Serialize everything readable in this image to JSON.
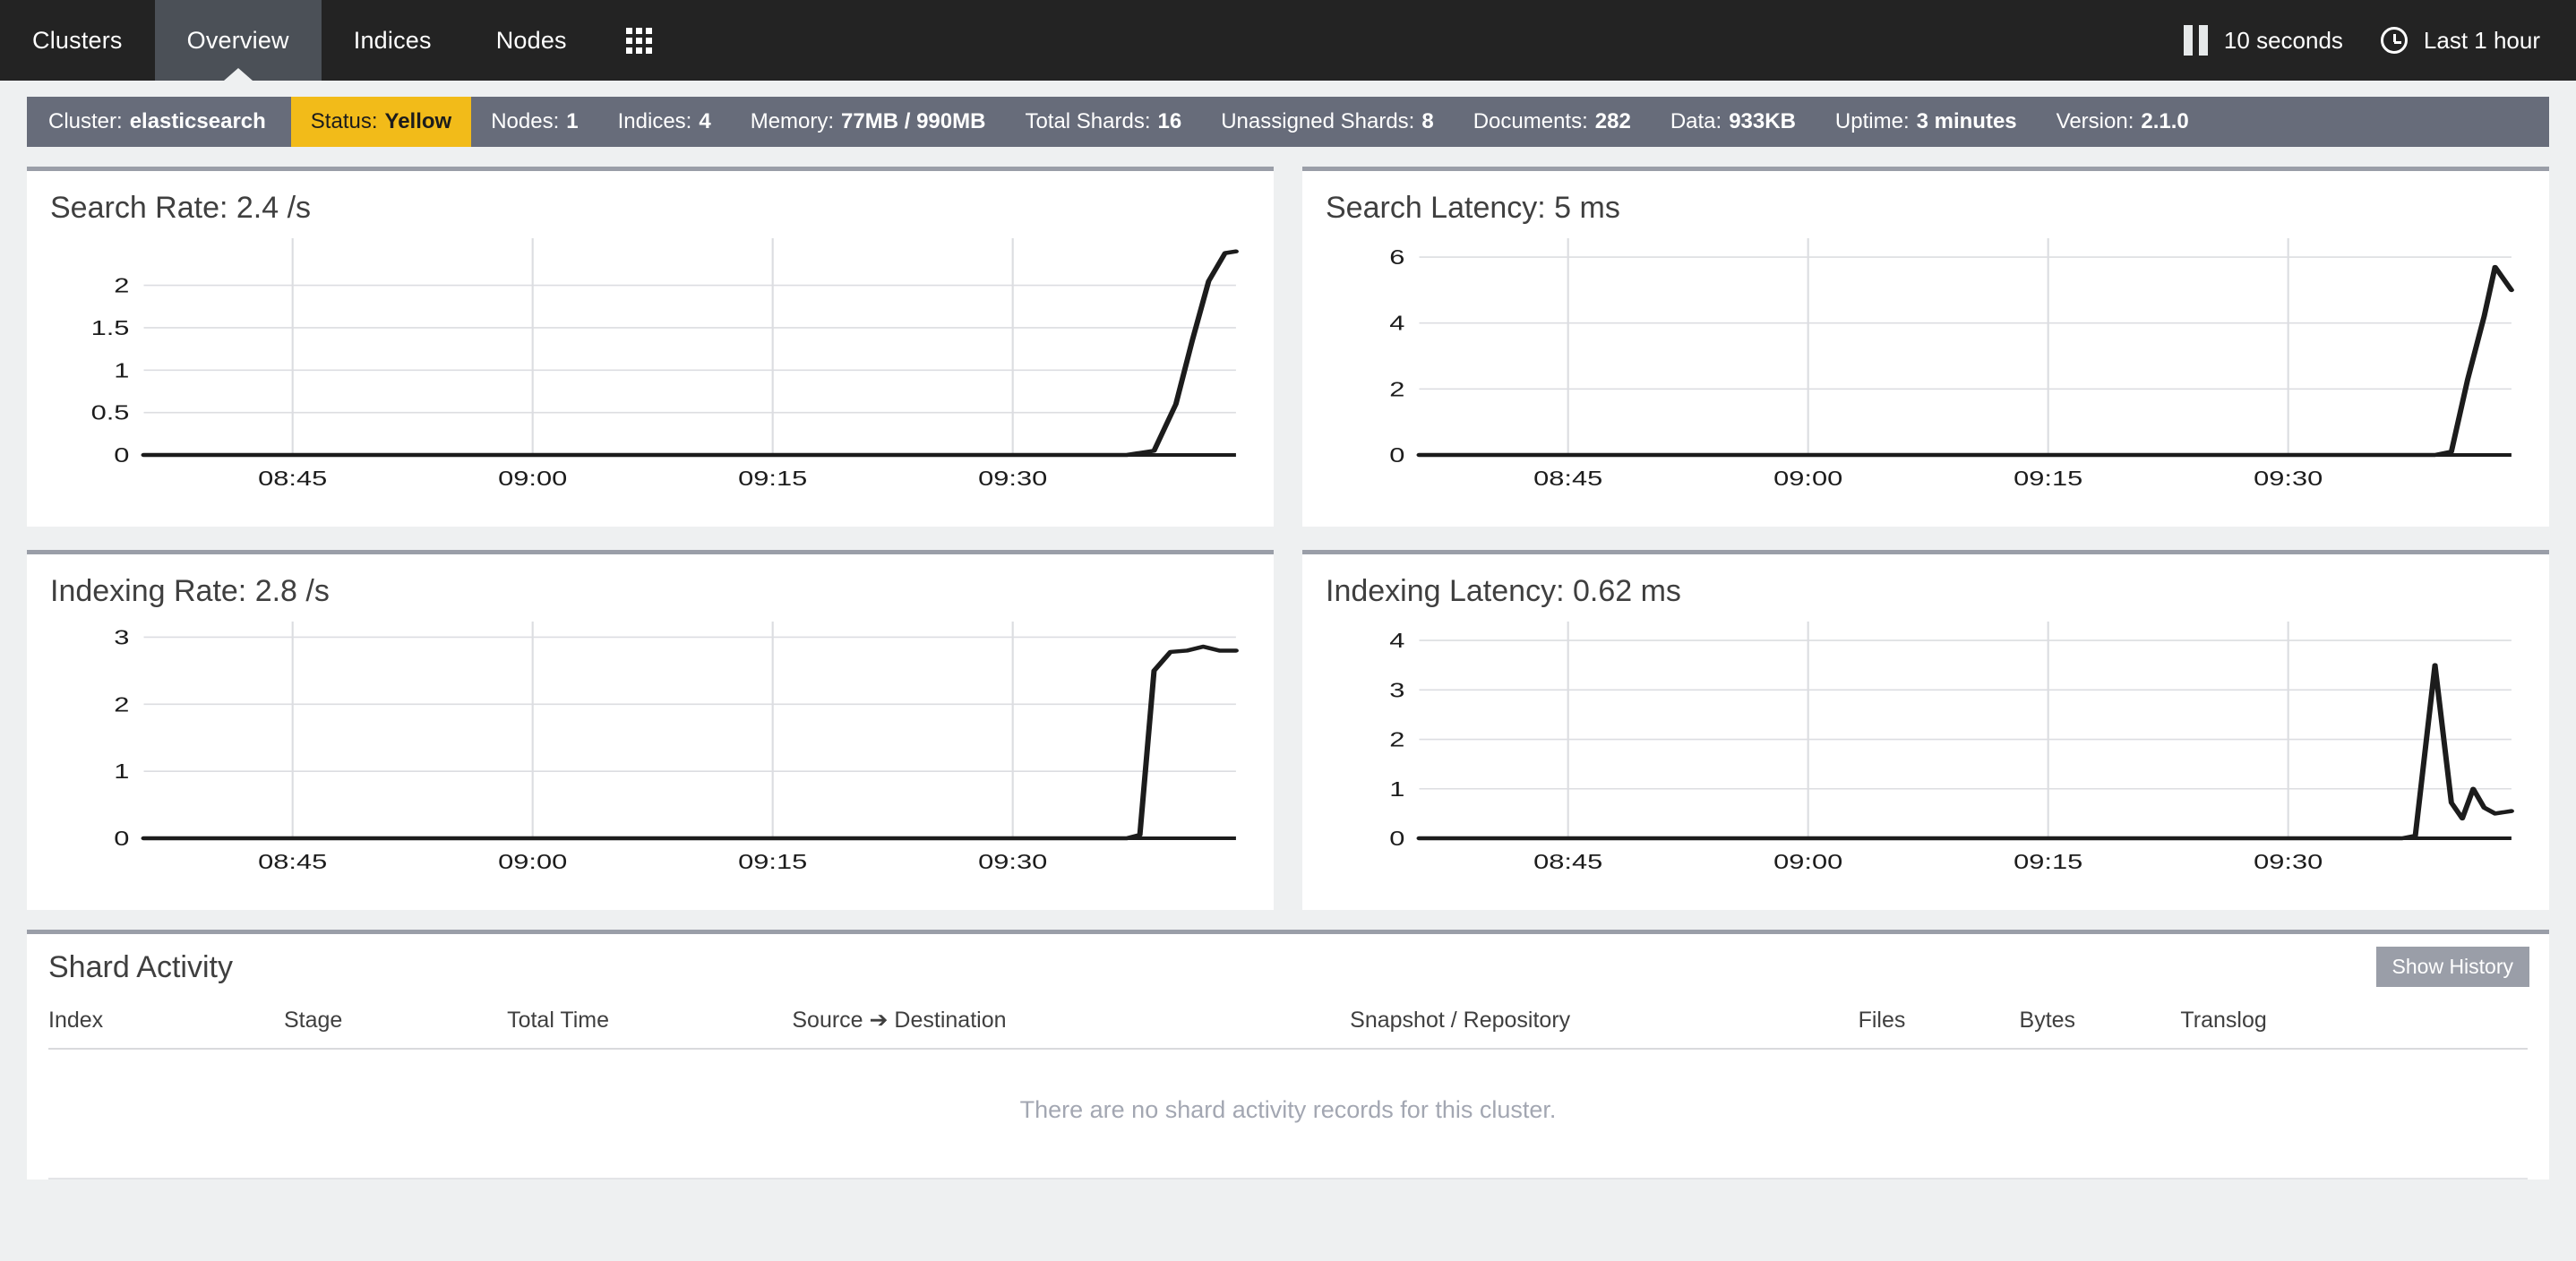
{
  "nav": {
    "items": [
      {
        "label": "Clusters",
        "active": false
      },
      {
        "label": "Overview",
        "active": true
      },
      {
        "label": "Indices",
        "active": false
      },
      {
        "label": "Nodes",
        "active": false
      }
    ],
    "grid_icon": "apps-grid-icon",
    "refresh": {
      "icon": "pause-icon",
      "label": "10 seconds"
    },
    "timerange": {
      "icon": "clock-icon",
      "label": "Last 1 hour"
    }
  },
  "statusbar": {
    "cells": [
      {
        "label": "Cluster:",
        "value": "elasticsearch",
        "highlight": false
      },
      {
        "label": "Status:",
        "value": "Yellow",
        "highlight": true
      },
      {
        "label": "Nodes:",
        "value": "1",
        "highlight": false
      },
      {
        "label": "Indices:",
        "value": "4",
        "highlight": false
      },
      {
        "label": "Memory:",
        "value": "77MB / 990MB",
        "highlight": false
      },
      {
        "label": "Total Shards:",
        "value": "16",
        "highlight": false
      },
      {
        "label": "Unassigned Shards:",
        "value": "8",
        "highlight": false
      },
      {
        "label": "Documents:",
        "value": "282",
        "highlight": false
      },
      {
        "label": "Data:",
        "value": "933KB",
        "highlight": false
      },
      {
        "label": "Uptime:",
        "value": "3 minutes",
        "highlight": false
      },
      {
        "label": "Version:",
        "value": "2.1.0",
        "highlight": false
      }
    ],
    "status_color": "#f2bb19",
    "bar_color": "#676c7a"
  },
  "panels": [
    {
      "title": "Search Rate: 2.4 /s"
    },
    {
      "title": "Search Latency: 5 ms"
    },
    {
      "title": "Indexing Rate: 2.8 /s"
    },
    {
      "title": "Indexing Latency: 0.62 ms"
    }
  ],
  "shard_activity": {
    "title": "Shard Activity",
    "show_history_label": "Show History",
    "columns": [
      "Index",
      "Stage",
      "Total Time",
      "Source ➔ Destination",
      "Snapshot / Repository",
      "Files",
      "Bytes",
      "Translog"
    ],
    "empty_message": "There are no shard activity records for this cluster.",
    "rows": []
  },
  "chart_data": [
    {
      "type": "line",
      "title": "Search Rate: 2.4 /s",
      "xlabel": "",
      "ylabel": "",
      "ylim": [
        0,
        2.45
      ],
      "yticks": [
        0,
        0.5,
        1,
        1.5,
        2
      ],
      "ytick_labels": [
        "0",
        "0.5",
        "1",
        "1.5",
        "2"
      ],
      "xticks": [
        "08:45",
        "09:00",
        "09:15",
        "09:30"
      ],
      "xlim": [
        "08:33",
        "09:38"
      ],
      "grid": true,
      "legend": "none",
      "x": [
        0,
        0.1,
        0.2,
        0.3,
        0.4,
        0.5,
        0.6,
        0.7,
        0.8,
        0.88,
        0.9,
        0.925,
        0.945,
        0.96,
        0.975,
        0.99,
        1.0
      ],
      "values": [
        0,
        0,
        0,
        0,
        0,
        0,
        0,
        0,
        0,
        0,
        0,
        0.05,
        0.6,
        1.35,
        2.05,
        2.38,
        2.4
      ]
    },
    {
      "type": "line",
      "title": "Search Latency: 5 ms",
      "xlabel": "",
      "ylabel": "",
      "ylim": [
        0,
        6.3
      ],
      "yticks": [
        0,
        2,
        4,
        6
      ],
      "ytick_labels": [
        "0",
        "2",
        "4",
        "6"
      ],
      "xticks": [
        "08:45",
        "09:00",
        "09:15",
        "09:30"
      ],
      "xlim": [
        "08:33",
        "09:38"
      ],
      "grid": true,
      "legend": "none",
      "x": [
        0,
        0.1,
        0.2,
        0.3,
        0.4,
        0.5,
        0.6,
        0.7,
        0.8,
        0.88,
        0.93,
        0.945,
        0.96,
        0.975,
        0.985,
        1.0
      ],
      "values": [
        0,
        0,
        0,
        0,
        0,
        0,
        0,
        0,
        0,
        0,
        0,
        0.1,
        2.3,
        4.2,
        5.7,
        5.0
      ]
    },
    {
      "type": "line",
      "title": "Indexing Rate: 2.8 /s",
      "xlabel": "",
      "ylabel": "",
      "ylim": [
        0,
        3.1
      ],
      "yticks": [
        0,
        1,
        2,
        3
      ],
      "ytick_labels": [
        "0",
        "1",
        "2",
        "3"
      ],
      "xticks": [
        "08:45",
        "09:00",
        "09:15",
        "09:30"
      ],
      "xlim": [
        "08:33",
        "09:38"
      ],
      "grid": true,
      "legend": "none",
      "x": [
        0,
        0.1,
        0.2,
        0.3,
        0.4,
        0.5,
        0.6,
        0.7,
        0.8,
        0.87,
        0.9,
        0.912,
        0.925,
        0.94,
        0.955,
        0.97,
        0.985,
        1.0
      ],
      "values": [
        0,
        0,
        0,
        0,
        0,
        0,
        0,
        0,
        0,
        0,
        0,
        0.05,
        2.5,
        2.78,
        2.8,
        2.86,
        2.8,
        2.8
      ]
    },
    {
      "type": "line",
      "title": "Indexing Latency: 0.62 ms",
      "xlabel": "",
      "ylabel": "",
      "ylim": [
        0,
        4.2
      ],
      "yticks": [
        0,
        1,
        2,
        3,
        4
      ],
      "ytick_labels": [
        "0",
        "1",
        "2",
        "3",
        "4"
      ],
      "xticks": [
        "08:45",
        "09:00",
        "09:15",
        "09:30"
      ],
      "xlim": [
        "08:33",
        "09:38"
      ],
      "grid": true,
      "legend": "none",
      "x": [
        0,
        0.1,
        0.2,
        0.3,
        0.4,
        0.5,
        0.6,
        0.7,
        0.8,
        0.87,
        0.9,
        0.912,
        0.93,
        0.945,
        0.955,
        0.965,
        0.975,
        0.985,
        1.0
      ],
      "values": [
        0,
        0,
        0,
        0,
        0,
        0,
        0,
        0,
        0,
        0,
        0,
        0.05,
        3.5,
        0.72,
        0.4,
        1.0,
        0.62,
        0.5,
        0.55
      ]
    }
  ],
  "colors": {
    "nav_bg": "#232323",
    "nav_active_bg": "#4b5057",
    "page_bg": "#eef0f1",
    "panel_border": "#9a9ea8",
    "line": "#1c1c1c",
    "grid": "#dcdde1",
    "muted_text": "#a3a7b2"
  }
}
